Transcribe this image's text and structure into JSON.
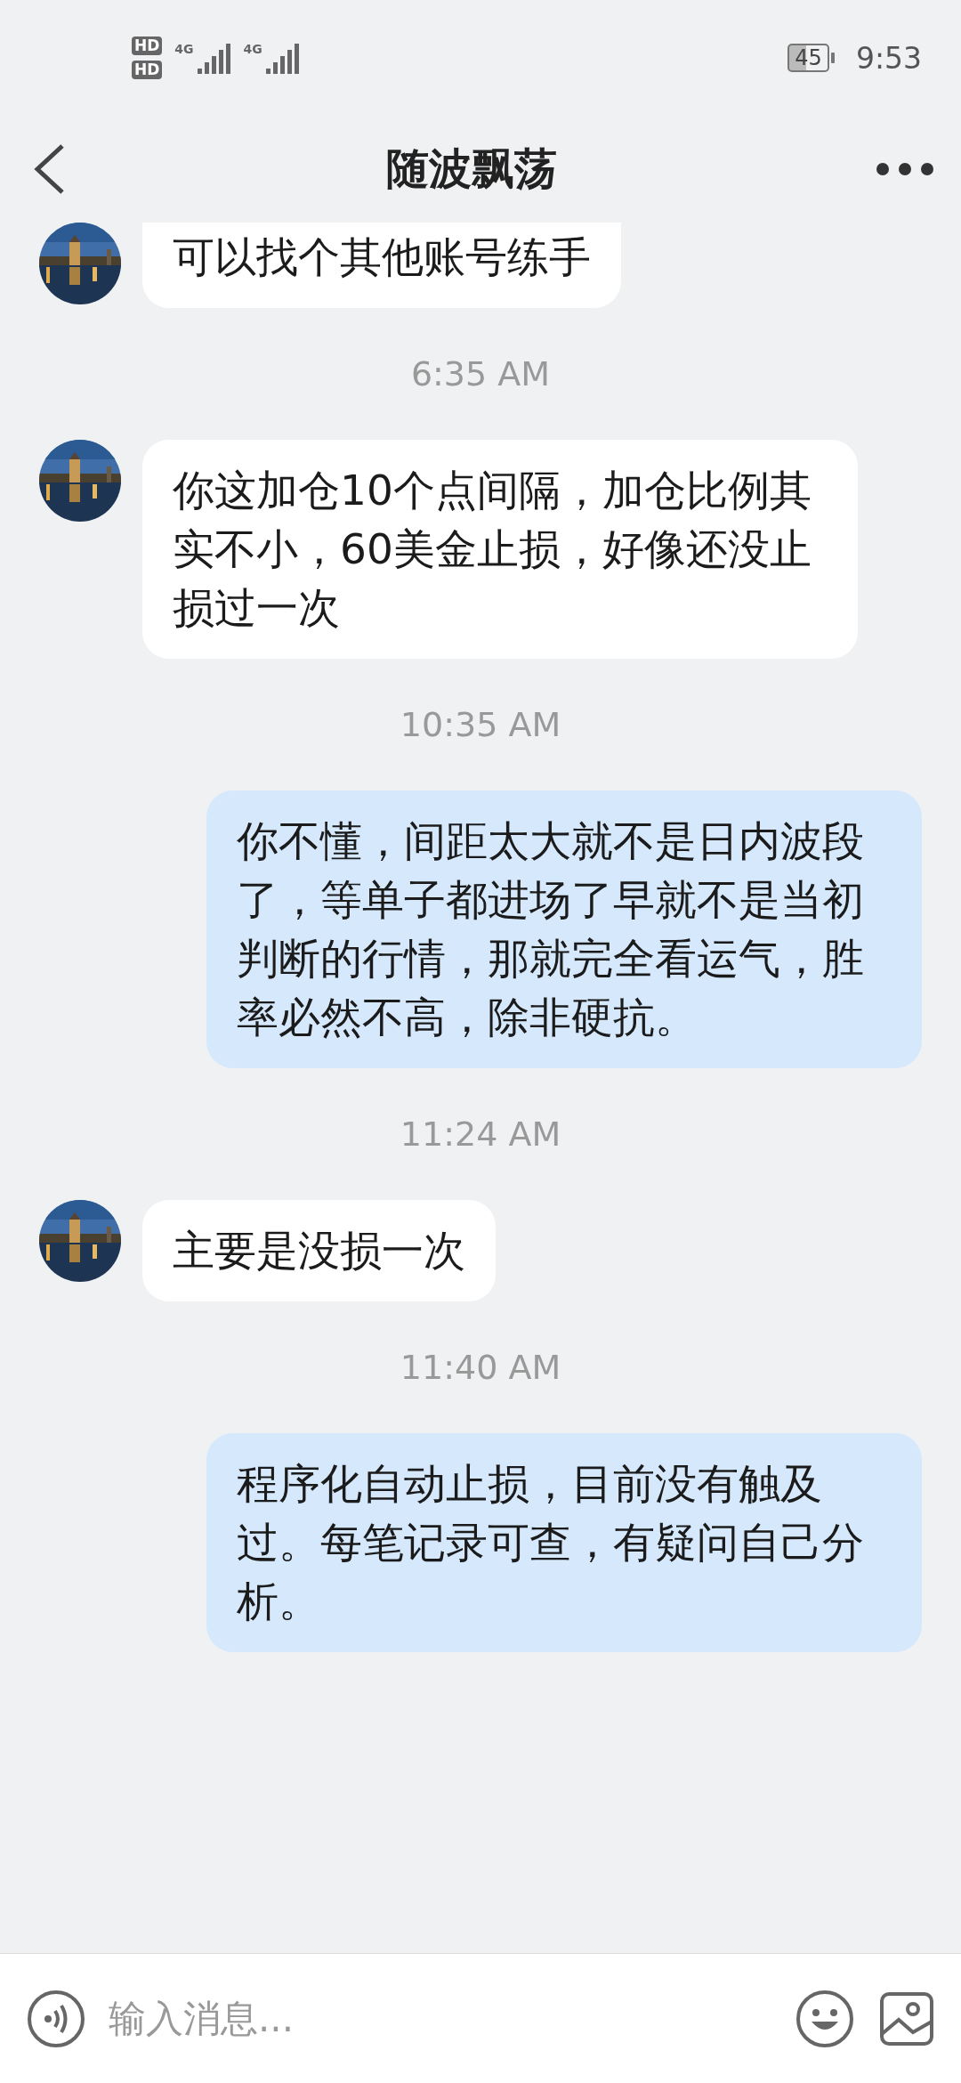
{
  "status_bar": {
    "sim_labels": [
      "HD",
      "HD"
    ],
    "network_labels": [
      "4G",
      "4G"
    ],
    "battery": "45",
    "time": "9:53"
  },
  "header": {
    "title": "随波飘荡"
  },
  "messages": [
    {
      "kind": "incoming",
      "text": "可以找个其他账号练手"
    },
    {
      "kind": "time",
      "text": "6:35 AM"
    },
    {
      "kind": "incoming",
      "text": "你这加仓10个点间隔，加仓比例其实不小，60美金止损，好像还没止损过一次"
    },
    {
      "kind": "time",
      "text": "10:35 AM"
    },
    {
      "kind": "outgoing",
      "text": "你不懂，间距太大就不是日内波段了，等单子都进场了早就不是当初判断的行情，那就完全看运气，胜率必然不高，除非硬抗。"
    },
    {
      "kind": "time",
      "text": "11:24 AM"
    },
    {
      "kind": "incoming",
      "text": "主要是没损一次"
    },
    {
      "kind": "time",
      "text": "11:40 AM"
    },
    {
      "kind": "outgoing",
      "text": "程序化自动止损，目前没有触及过。每笔记录可查，有疑问自己分析。"
    }
  ],
  "input": {
    "placeholder": "输入消息..."
  }
}
